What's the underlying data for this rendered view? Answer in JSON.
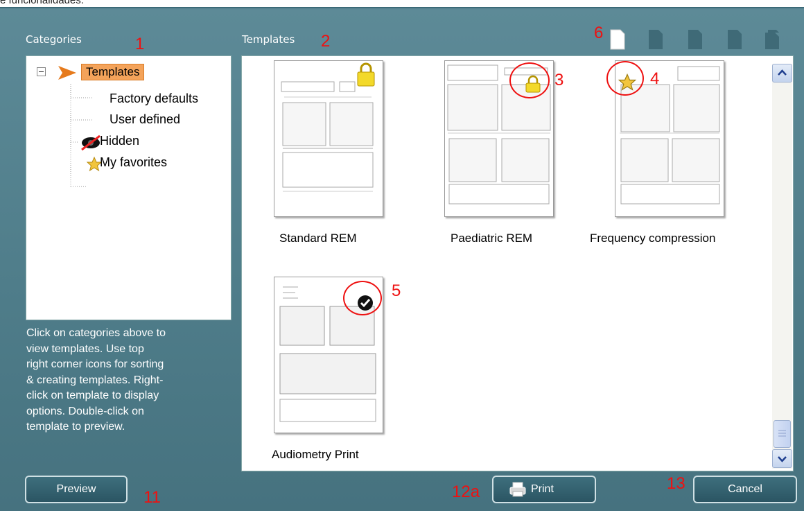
{
  "page": {
    "cropped_top_text": "e funcionalidades."
  },
  "headers": {
    "categories": "Categories",
    "templates": "Templates"
  },
  "callouts": {
    "n1": "1",
    "n2": "2",
    "n3": "3",
    "n4": "4",
    "n5": "5",
    "n6": "6",
    "n11": "11",
    "n12a": "12a",
    "n13": "13"
  },
  "tree": {
    "root_label": "Templates",
    "items": [
      {
        "label": "Factory defaults",
        "icon": "none"
      },
      {
        "label": "User defined",
        "icon": "none"
      },
      {
        "label": "Hidden",
        "icon": "crossed-eye-icon"
      },
      {
        "label": "My favorites",
        "icon": "star-icon"
      }
    ]
  },
  "help_text": {
    "lines": [
      "Click on categories above to",
      "view templates. Use top",
      "right corner icons for sorting",
      "& creating templates. Right-",
      "click on template to display",
      "options. Double-click on",
      "template to preview."
    ]
  },
  "templates": [
    {
      "label": "Standard REM",
      "badge": "lock-icon"
    },
    {
      "label": "Paediatric REM",
      "badge": "lock-icon"
    },
    {
      "label": "Frequency compression",
      "badge": "star-icon"
    },
    {
      "label": "Audiometry Print",
      "badge": "checkmark-icon"
    }
  ],
  "buttons": {
    "preview": "Preview",
    "print": "Print",
    "cancel": "Cancel"
  },
  "colors": {
    "dialog_bg": "#4f7d8a",
    "button_bg": "#2b5563",
    "callout_red": "#e11111",
    "tree_selected": "#f4a35a"
  }
}
